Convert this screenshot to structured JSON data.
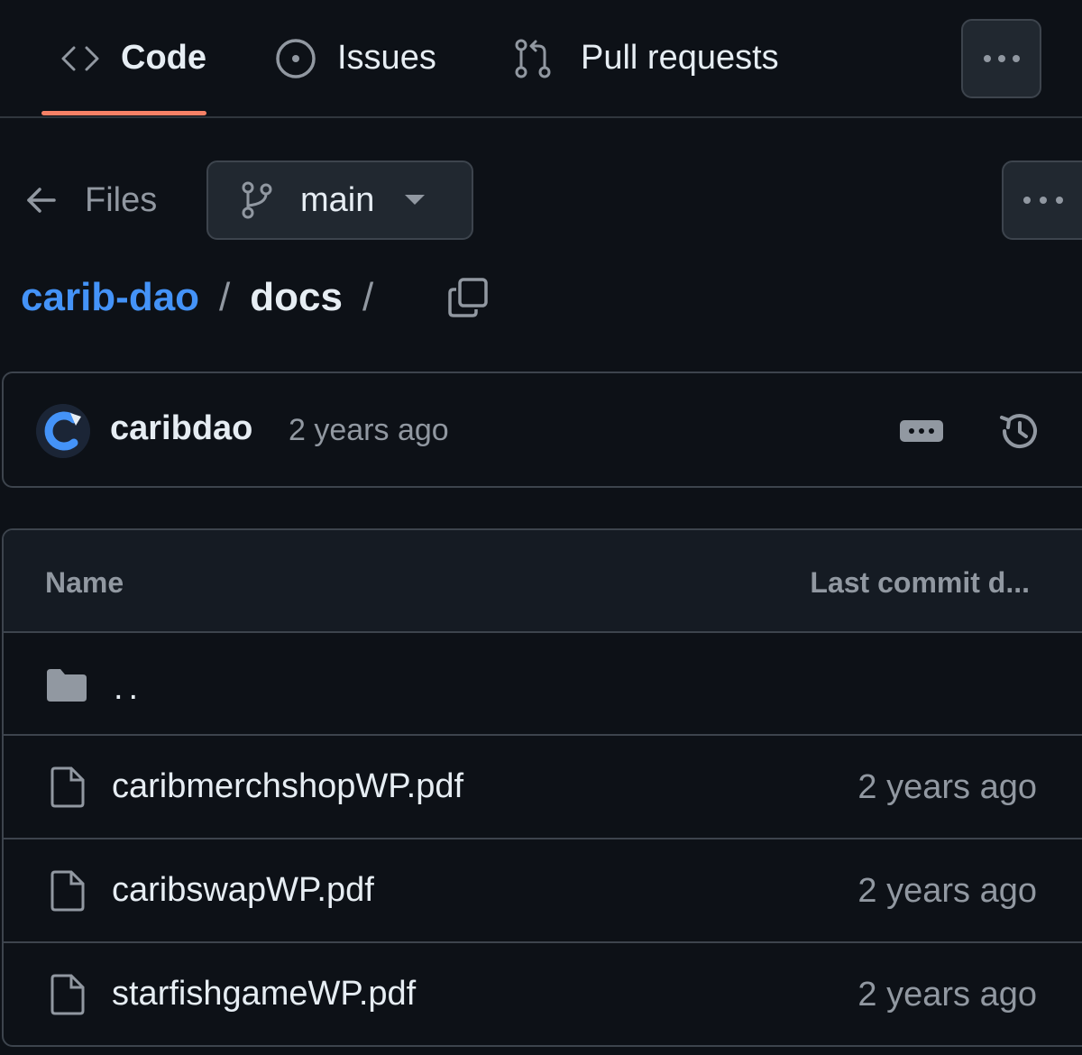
{
  "tabs": [
    {
      "label": "Code",
      "icon": "code-icon",
      "selected": true
    },
    {
      "label": "Issues",
      "icon": "issue-opened-icon",
      "selected": false
    },
    {
      "label": "Pull requests",
      "icon": "git-pull-request-icon",
      "selected": false
    }
  ],
  "files_nav": {
    "back_label": "Files",
    "branch": "main"
  },
  "breadcrumb": {
    "repo": "carib-dao",
    "separator": "/",
    "directory": "docs"
  },
  "latest_commit": {
    "author": "caribdao",
    "time": "2 years ago"
  },
  "file_table": {
    "headers": {
      "name": "Name",
      "date": "Last commit d..."
    },
    "parent_label": "..",
    "rows": [
      {
        "name": "caribmerchshopWP.pdf",
        "date": "2 years ago"
      },
      {
        "name": "caribswapWP.pdf",
        "date": "2 years ago"
      },
      {
        "name": "starfishgameWP.pdf",
        "date": "2 years ago"
      }
    ]
  },
  "colors": {
    "background": "#0d1117",
    "accent_underline": "#f78166",
    "link": "#4493f8",
    "muted": "#9198a1",
    "border": "#3d444d"
  }
}
